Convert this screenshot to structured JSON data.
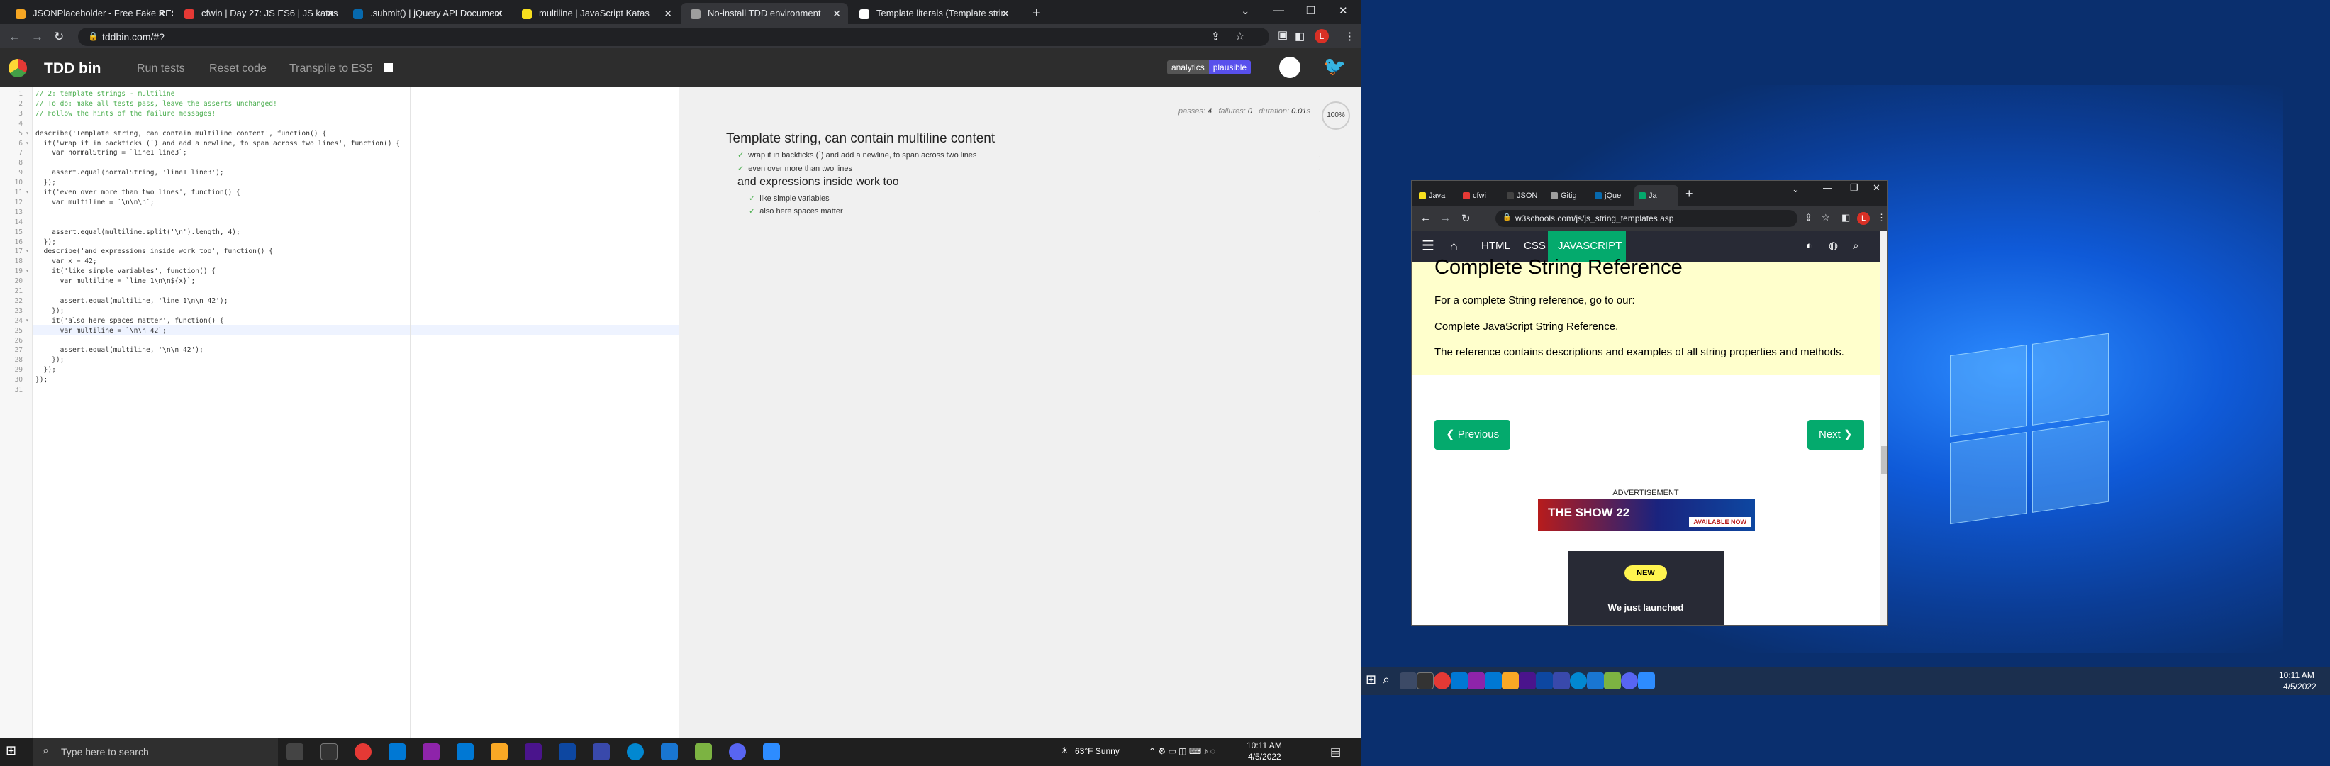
{
  "browser_tabs": [
    {
      "label": "JSONPlaceholder - Free Fake RES",
      "color": "#f5a623"
    },
    {
      "label": "cfwin | Day 27: JS ES6 | JS katas",
      "color": "#e53935"
    },
    {
      "label": ".submit() | jQuery API Document",
      "color": "#0769ad"
    },
    {
      "label": "multiline | JavaScript Katas",
      "color": "#f7df1e"
    },
    {
      "label": "No-install TDD environment",
      "color": "#9e9e9e"
    },
    {
      "label": "Template literals (Template strin",
      "color": "#ffffff"
    }
  ],
  "url": "tddbin.com/#?",
  "avatar_letter": "L",
  "tdd": {
    "title": "TDD bin",
    "run": "Run tests",
    "reset": "Reset code",
    "transpile": "Transpile to ES5",
    "analytics": "analytics",
    "plausible": "plausible"
  },
  "code_lines": [
    {
      "n": "1",
      "t": "// 2: template strings - multiline",
      "c": "cmt"
    },
    {
      "n": "2",
      "t": "// To do: make all tests pass, leave the asserts unchanged!",
      "c": "cmt"
    },
    {
      "n": "3",
      "t": "// Follow the hints of the failure messages!",
      "c": "cmt"
    },
    {
      "n": "4",
      "t": "",
      "c": ""
    },
    {
      "n": "5",
      "t": "describe('Template string, can contain multiline content', function() {",
      "c": ""
    },
    {
      "n": "6",
      "t": "  it('wrap it in backticks (`) and add a newline, to span across two lines', function() {",
      "c": ""
    },
    {
      "n": "7",
      "t": "    var normalString = `line1 line3`;",
      "c": ""
    },
    {
      "n": "8",
      "t": "",
      "c": ""
    },
    {
      "n": "9",
      "t": "    assert.equal(normalString, 'line1 line3');",
      "c": ""
    },
    {
      "n": "10",
      "t": "  });",
      "c": ""
    },
    {
      "n": "11",
      "t": "  it('even over more than two lines', function() {",
      "c": ""
    },
    {
      "n": "12",
      "t": "    var multiline = `\\n\\n\\n`;",
      "c": ""
    },
    {
      "n": "13",
      "t": "",
      "c": ""
    },
    {
      "n": "14",
      "t": "",
      "c": ""
    },
    {
      "n": "15",
      "t": "    assert.equal(multiline.split('\\n').length, 4);",
      "c": ""
    },
    {
      "n": "16",
      "t": "  });",
      "c": ""
    },
    {
      "n": "17",
      "t": "  describe('and expressions inside work too', function() {",
      "c": ""
    },
    {
      "n": "18",
      "t": "    var x = 42;",
      "c": ""
    },
    {
      "n": "19",
      "t": "    it('like simple variables', function() {",
      "c": ""
    },
    {
      "n": "20",
      "t": "      var multiline = `line 1\\n\\n${x}`;",
      "c": ""
    },
    {
      "n": "21",
      "t": "",
      "c": ""
    },
    {
      "n": "22",
      "t": "      assert.equal(multiline, 'line 1\\n\\n 42');",
      "c": ""
    },
    {
      "n": "23",
      "t": "    });",
      "c": ""
    },
    {
      "n": "24",
      "t": "    it('also here spaces matter', function() {",
      "c": ""
    },
    {
      "n": "25",
      "t": "      var multiline = `\\n\\n 42`;",
      "c": ""
    },
    {
      "n": "26",
      "t": "",
      "c": ""
    },
    {
      "n": "27",
      "t": "      assert.equal(multiline, '\\n\\n 42');",
      "c": ""
    },
    {
      "n": "28",
      "t": "    });",
      "c": ""
    },
    {
      "n": "29",
      "t": "  });",
      "c": ""
    },
    {
      "n": "30",
      "t": "});",
      "c": ""
    },
    {
      "n": "31",
      "t": "",
      "c": ""
    }
  ],
  "results": {
    "passes_label": "passes:",
    "passes": "4",
    "failures_label": "failures:",
    "failures": "0",
    "duration_label": "duration:",
    "duration": "0.01",
    "duration_unit": "s",
    "percent": "100%",
    "suite1": "Template string, can contain multiline content",
    "spec1": "wrap it in backticks (`) and add a newline, to span across two lines",
    "spec2": "even over more than two lines",
    "suite2": "and expressions inside work too",
    "spec3": "like simple variables",
    "spec4": "also here spaces matter",
    "check": "✓",
    "dot": "."
  },
  "taskbar": {
    "search_placeholder": "Type here to search",
    "weather": "63°F  Sunny",
    "time": "10:11 AM",
    "date": "4/5/2022"
  },
  "w3": {
    "tabs": [
      "Java",
      "cfwi",
      "JSON",
      "Gitig",
      "jQue",
      "Ja"
    ],
    "url": "w3schools.com/js/js_string_templates.asp",
    "nav": [
      "HTML",
      "CSS",
      "JAVASCRIPT"
    ],
    "heading": "Complete String Reference",
    "p1": "For a complete String reference, go to our:",
    "link": "Complete JavaScript String Reference",
    "link_end": ".",
    "p3": "The reference contains descriptions and examples of all string properties and methods.",
    "prev": "❮ Previous",
    "next": "Next ❯",
    "ad_label": "ADVERTISEMENT",
    "ad_text": "THE SHOW 22",
    "ad_cta": "AVAILABLE NOW",
    "new_badge": "NEW",
    "launched": "We just launched"
  },
  "taskbar_right": {
    "time": "10:11 AM",
    "date": "4/5/2022"
  }
}
